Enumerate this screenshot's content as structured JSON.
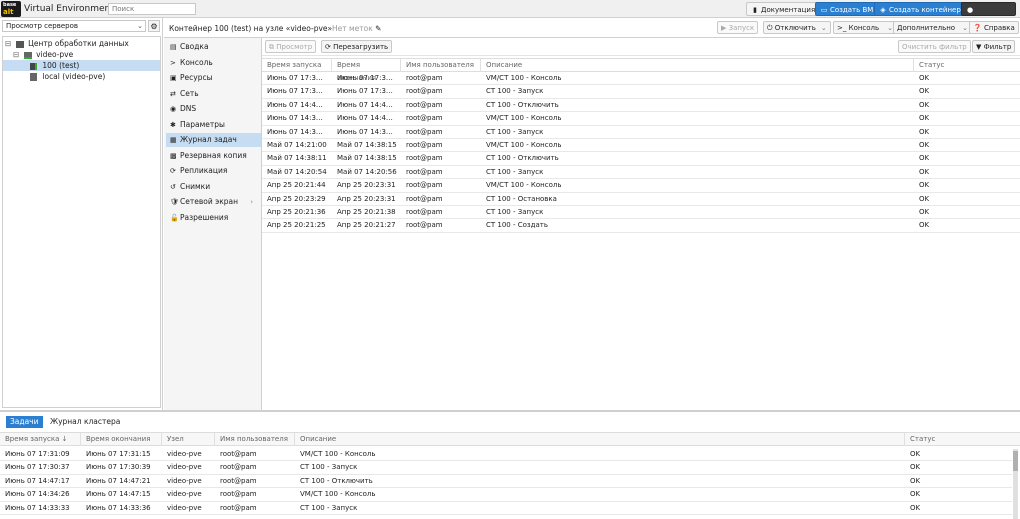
{
  "topbar": {
    "logo_top": "base",
    "logo_bottom": "alt",
    "brand": "Virtual Environment",
    "search_placeholder": "Поиск",
    "docs_label": "Документация",
    "create_vm_label": "Создать ВМ",
    "create_ct_label": "Создать контейнер",
    "user_label": ""
  },
  "left": {
    "view_select": "Просмотр серверов",
    "tree": [
      {
        "label": "Центр обработки данных",
        "icon": "server-rack-icon"
      },
      {
        "label": "video-pve",
        "icon": "node-icon"
      },
      {
        "label": "100 (test)",
        "icon": "container-icon"
      },
      {
        "label": "local (video-pve)",
        "icon": "storage-icon"
      }
    ]
  },
  "content_header": {
    "title": "Контейнер 100 (test) на узле «video-pve»",
    "tags": "Нет меток",
    "start_label": "Запуск",
    "shutdown_label": "Отключить",
    "console_label": "Консоль",
    "more_label": "Дополнительно",
    "help_label": "Справка"
  },
  "nav": [
    {
      "label": "Сводка",
      "icon": "summary-icon"
    },
    {
      "label": "Консоль",
      "icon": "console-icon"
    },
    {
      "label": "Ресурсы",
      "icon": "resources-icon"
    },
    {
      "label": "Сеть",
      "icon": "network-icon"
    },
    {
      "label": "DNS",
      "icon": "dns-icon"
    },
    {
      "label": "Параметры",
      "icon": "options-icon"
    },
    {
      "label": "Журнал задач",
      "icon": "tasklog-icon"
    },
    {
      "label": "Резервная копия",
      "icon": "backup-icon"
    },
    {
      "label": "Репликация",
      "icon": "replication-icon"
    },
    {
      "label": "Снимки",
      "icon": "snapshot-icon"
    },
    {
      "label": "Сетевой экран",
      "icon": "firewall-icon"
    },
    {
      "label": "Разрешения",
      "icon": "permissions-icon"
    }
  ],
  "tasks_toolbar": {
    "view_label": "Просмотр",
    "restart_label": "Перезагрузить",
    "clear_filter_label": "Очистить фильтр",
    "filter_label": "Фильтр"
  },
  "tasks": {
    "columns": [
      "Время запуска",
      "Время окончания",
      "Имя пользователя",
      "Описание",
      "Статус"
    ],
    "rows": [
      [
        "Июнь 07 17:3…",
        "Июнь 07 17:3…",
        "root@pam",
        "VM/CT 100 - Консоль",
        "OK"
      ],
      [
        "Июнь 07 17:3…",
        "Июнь 07 17:3…",
        "root@pam",
        "CT 100 - Запуск",
        "OK"
      ],
      [
        "Июнь 07 14:4…",
        "Июнь 07 14:4…",
        "root@pam",
        "CT 100 - Отключить",
        "OK"
      ],
      [
        "Июнь 07 14:3…",
        "Июнь 07 14:4…",
        "root@pam",
        "VM/CT 100 - Консоль",
        "OK"
      ],
      [
        "Июнь 07 14:3…",
        "Июнь 07 14:3…",
        "root@pam",
        "CT 100 - Запуск",
        "OK"
      ],
      [
        "Май 07 14:21:00",
        "Май 07 14:38:15",
        "root@pam",
        "VM/CT 100 - Консоль",
        "OK"
      ],
      [
        "Май 07 14:38:11",
        "Май 07 14:38:15",
        "root@pam",
        "CT 100 - Отключить",
        "OK"
      ],
      [
        "Май 07 14:20:54",
        "Май 07 14:20:56",
        "root@pam",
        "CT 100 - Запуск",
        "OK"
      ],
      [
        "Апр 25 20:21:44",
        "Апр 25 20:23:31",
        "root@pam",
        "VM/CT 100 - Консоль",
        "OK"
      ],
      [
        "Апр 25 20:23:29",
        "Апр 25 20:23:31",
        "root@pam",
        "CT 100 - Остановка",
        "OK"
      ],
      [
        "Апр 25 20:21:36",
        "Апр 25 20:21:38",
        "root@pam",
        "CT 100 - Запуск",
        "OK"
      ],
      [
        "Апр 25 20:21:25",
        "Апр 25 20:21:27",
        "root@pam",
        "CT 100 - Создать",
        "OK"
      ]
    ]
  },
  "bottom": {
    "tab_tasks": "Задачи",
    "tab_cluster_log": "Журнал кластера",
    "columns": [
      "Время запуска ↓",
      "Время окончания",
      "Узел",
      "Имя пользователя",
      "Описание",
      "Статус"
    ],
    "rows": [
      [
        "Июнь 07 17:31:09",
        "Июнь 07 17:31:15",
        "video-pve",
        "root@pam",
        "VM/CT 100 - Консоль",
        "OK"
      ],
      [
        "Июнь 07 17:30:37",
        "Июнь 07 17:30:39",
        "video-pve",
        "root@pam",
        "CT 100 - Запуск",
        "OK"
      ],
      [
        "Июнь 07 14:47:17",
        "Июнь 07 14:47:21",
        "video-pve",
        "root@pam",
        "CT 100 - Отключить",
        "OK"
      ],
      [
        "Июнь 07 14:34:26",
        "Июнь 07 14:47:15",
        "video-pve",
        "root@pam",
        "VM/CT 100 - Консоль",
        "OK"
      ],
      [
        "Июнь 07 14:33:33",
        "Июнь 07 14:33:36",
        "video-pve",
        "root@pam",
        "CT 100 - Запуск",
        "OK"
      ]
    ]
  }
}
